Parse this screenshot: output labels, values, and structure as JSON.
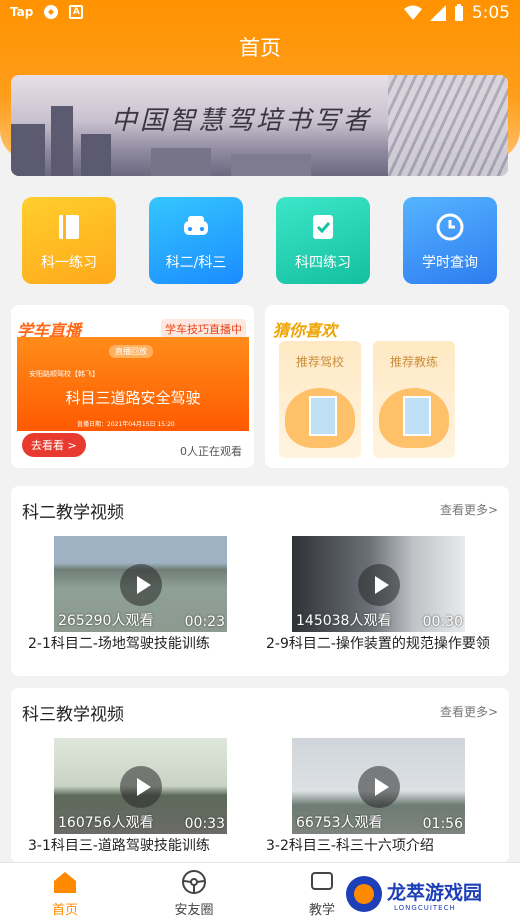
{
  "status_bar": {
    "carrier": "Tap",
    "time": "5:05"
  },
  "header": {
    "title": "首页"
  },
  "banner": {
    "text": "中国智慧驾培书写者"
  },
  "tools": [
    {
      "label": "科一练习",
      "icon": "book-icon"
    },
    {
      "label": "科二/科三",
      "icon": "car-icon"
    },
    {
      "label": "科四练习",
      "icon": "checklist-icon"
    },
    {
      "label": "学时查询",
      "icon": "clock-icon"
    }
  ],
  "live": {
    "title": "学车直播",
    "tag": "学车技巧直播中",
    "poster_chip": "直播回放",
    "poster_school": "安阳路顺驾校【韩飞】",
    "poster_subject": "科目三道路安全驾驶",
    "poster_date": "直播日期：2021年04月15日 15:20",
    "go_button": "去看看 >",
    "watching": "0人正在观看"
  },
  "recommend": {
    "title": "猜你喜欢",
    "items": [
      "推荐驾校",
      "推荐教练"
    ]
  },
  "sections": [
    {
      "title": "科二教学视频",
      "more": "查看更多>",
      "videos": [
        {
          "views": "265290人观看",
          "duration": "00:23",
          "caption": "2-1科目二-场地驾驶技能训练"
        },
        {
          "views": "145038人观看",
          "duration": "00:30",
          "caption": "2-9科目二-操作装置的规范操作要领"
        }
      ]
    },
    {
      "title": "科三教学视频",
      "more": "查看更多>",
      "videos": [
        {
          "views": "160756人观看",
          "duration": "00:33",
          "caption": "3-1科目三-道路驾驶技能训练"
        },
        {
          "views": "66753人观看",
          "duration": "01:56",
          "caption": "3-2科目三-科三十六项介绍"
        }
      ]
    }
  ],
  "nav": [
    {
      "label": "首页",
      "icon": "home-icon"
    },
    {
      "label": "安友圈",
      "icon": "steering-wheel-icon"
    },
    {
      "label": "教学",
      "icon": "teaching-icon"
    }
  ],
  "watermark": {
    "title": "龙萃游戏园",
    "subtitle": "LONGCUITECH"
  },
  "colors": {
    "accent": "#ff8a00",
    "live_red": "#e83a2e"
  }
}
